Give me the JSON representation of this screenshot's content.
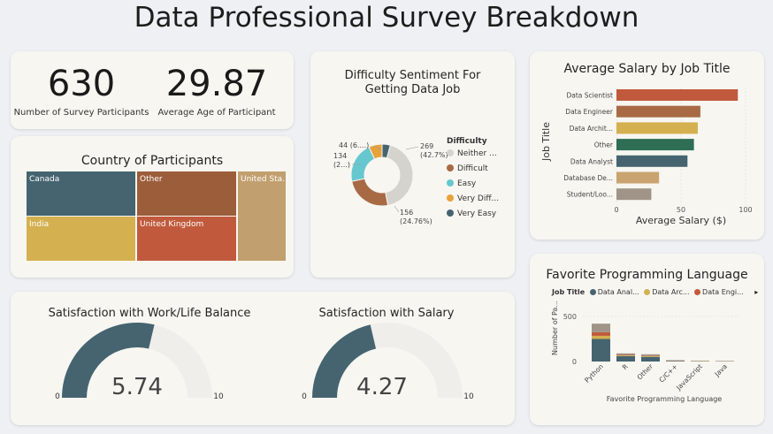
{
  "title": "Data Professional Survey Breakdown",
  "kpis": {
    "participants_value": "630",
    "participants_label": "Number of Survey Participants",
    "age_value": "29.87",
    "age_label": "Average Age of Participant"
  },
  "treemap": {
    "title": "Country of Participants",
    "cells": [
      {
        "label": "Canada",
        "color": "#456470"
      },
      {
        "label": "Other",
        "color": "#9c5d3a"
      },
      {
        "label": "United Sta...",
        "color": "#c19f6e"
      },
      {
        "label": "India",
        "color": "#d4b050"
      },
      {
        "label": "United Kingdom",
        "color": "#c15a3c"
      }
    ]
  },
  "donut": {
    "title_line1": "Difficulty Sentiment For",
    "title_line2": "Getting Data Job",
    "legend_title": "Difficulty",
    "legend": [
      {
        "label": "Neither ...",
        "color": "#d5d3ce"
      },
      {
        "label": "Difficult",
        "color": "#a86a44"
      },
      {
        "label": "Easy",
        "color": "#66c7cf"
      },
      {
        "label": "Very Diff...",
        "color": "#e8a23b"
      },
      {
        "label": "Very Easy",
        "color": "#456470"
      }
    ],
    "labels": {
      "neither_a": "269",
      "neither_b": "(42.7%)",
      "difficult_a": "156",
      "difficult_b": "(24.76%)",
      "easy_a": "134",
      "easy_b": "(2...)",
      "verydiff_a": "44 (6....)"
    }
  },
  "salary_chart": {
    "title": "Average Salary by Job Title",
    "ylabel": "Job Title",
    "xlabel": "Average Salary ($)",
    "ticks": [
      "0",
      "50",
      "100"
    ]
  },
  "language_chart": {
    "title": "Favorite Programming Language",
    "legend_title": "Job Title",
    "legend": [
      {
        "label": "Data Anal...",
        "color": "#456470"
      },
      {
        "label": "Data Arc...",
        "color": "#d4b050"
      },
      {
        "label": "Data Engi...",
        "color": "#c15a3c"
      }
    ],
    "legend_more": "▸",
    "ylabel": "Number of Pa...",
    "xlabel": "Favorite Programming Language",
    "yticks": [
      "500",
      "0"
    ]
  },
  "gauges": {
    "worklife_title": "Satisfaction with Work/Life Balance",
    "worklife_value": "5.74",
    "salary_title": "Satisfaction with Salary",
    "salary_value": "4.27",
    "min_label": "0",
    "max_label": "10",
    "worklife_fraction": 0.574,
    "salary_fraction": 0.427,
    "fill_color": "#456470",
    "track_color": "#efeeeb"
  },
  "chart_data": [
    {
      "type": "bar",
      "orientation": "horizontal",
      "title": "Average Salary by Job Title",
      "xlabel": "Average Salary ($)",
      "ylabel": "Job Title",
      "xlim": [
        0,
        100
      ],
      "categories": [
        "Data Scientist",
        "Data Engineer",
        "Data Archit...",
        "Other",
        "Data Analyst",
        "Database De...",
        "Student/Loo..."
      ],
      "values": [
        94,
        65,
        63,
        60,
        55,
        33,
        27
      ],
      "colors": [
        "#c15a3c",
        "#a86a44",
        "#d4b050",
        "#2d6e55",
        "#456470",
        "#c9a470",
        "#a09488"
      ]
    },
    {
      "type": "bar",
      "stacked": true,
      "title": "Favorite Programming Language",
      "xlabel": "Favorite Programming Language",
      "ylabel": "Number of Pa...",
      "ylim": [
        0,
        650
      ],
      "categories": [
        "Python",
        "R",
        "Other",
        "C/C++",
        "JavaScript",
        "Java"
      ],
      "series": [
        {
          "name": "Data Anal...",
          "values": [
            250,
            60,
            52,
            6,
            3,
            3
          ]
        },
        {
          "name": "Data Arc...",
          "values": [
            35,
            8,
            8,
            2,
            2,
            1
          ]
        },
        {
          "name": "Data Engi...",
          "values": [
            40,
            6,
            6,
            2,
            2,
            1
          ]
        },
        {
          "values": [
            95,
            16,
            14,
            5,
            3,
            2
          ]
        }
      ],
      "colors": [
        "#456470",
        "#d4b050",
        "#c15a3c",
        "#a09488"
      ]
    },
    {
      "type": "pie",
      "title": "Difficulty Sentiment For Getting Data Job",
      "categories": [
        "Neither ...",
        "Difficult",
        "Easy",
        "Very Diff...",
        "Very Easy"
      ],
      "values": [
        269,
        156,
        134,
        44,
        27
      ]
    }
  ]
}
